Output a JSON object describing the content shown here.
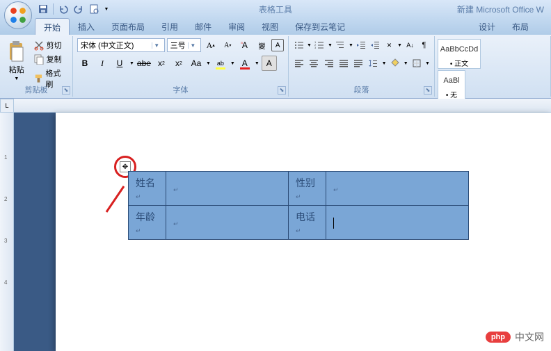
{
  "qat": {
    "save": "save-icon",
    "undo": "undo-icon",
    "redo": "redo-icon",
    "print": "print-icon"
  },
  "title": {
    "context_label": "表格工具",
    "doc_name": "新建 Microsoft Office W"
  },
  "tabs": {
    "home": "开始",
    "insert": "插入",
    "layout": "页面布局",
    "references": "引用",
    "mailings": "邮件",
    "review": "审阅",
    "view": "视图",
    "save_cloud": "保存到云笔记",
    "design": "设计",
    "table_layout": "布局"
  },
  "clipboard": {
    "paste": "粘贴",
    "cut": "剪切",
    "copy": "复制",
    "format_painter": "格式刷",
    "group_label": "剪贴板"
  },
  "font": {
    "family": "宋体 (中文正文)",
    "size": "三号",
    "group_label": "字体"
  },
  "paragraph": {
    "group_label": "段落"
  },
  "styles": {
    "item1_preview": "AaBbCcDd",
    "item1_name": "• 正文",
    "item2_preview": "AaBl",
    "item2_name": "• 无"
  },
  "ruler_corner": "L",
  "table": {
    "r1c1": "姓名",
    "r1c3": "性别",
    "r2c1": "年龄",
    "r2c3": "电话"
  },
  "watermark": {
    "badge": "php",
    "text": "中文网"
  }
}
